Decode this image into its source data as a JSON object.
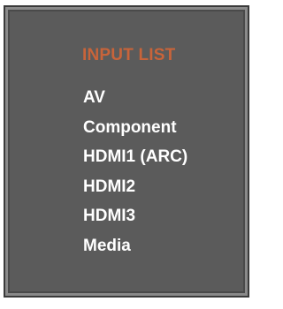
{
  "menu": {
    "title": "INPUT LIST",
    "items": [
      {
        "label": "AV"
      },
      {
        "label": "Component"
      },
      {
        "label": "HDMI1 (ARC)"
      },
      {
        "label": "HDMI2"
      },
      {
        "label": "HDMI3"
      },
      {
        "label": "Media"
      }
    ]
  },
  "colors": {
    "panel_background": "#5b5b5b",
    "title": "#c8643a",
    "item_text": "#ffffff"
  }
}
